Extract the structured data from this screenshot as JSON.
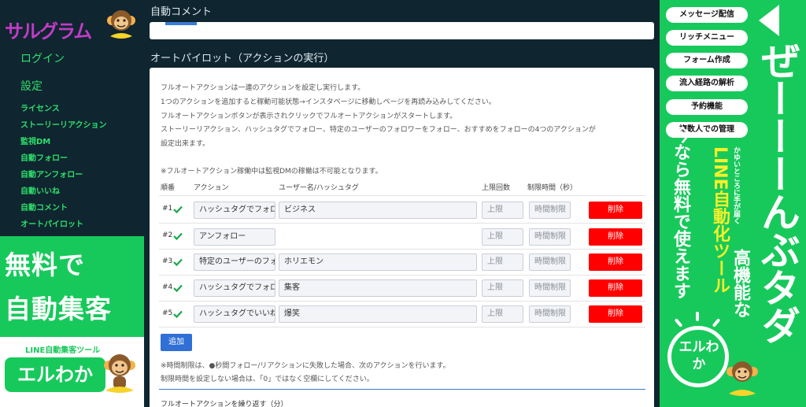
{
  "sidebar": {
    "logo_text": "サルグラム",
    "nav_big": [
      "ログイン",
      "設定"
    ],
    "nav_small": [
      "ライセンス",
      "ストーリーリアクション",
      "監視DM",
      "自動フォロー",
      "自動アンフォロー",
      "自動いいね",
      "自動コメント",
      "オートパイロット"
    ]
  },
  "left_ad": {
    "line1": "無料で",
    "line2": "自動集客",
    "tag": "LINE自動集客ツール",
    "brand": "エルわか"
  },
  "main": {
    "section_auto_comment": "自動コメント",
    "section_autopilot": "オートパイロット（アクションの実行）",
    "desc": [
      "フルオートアクションは一連のアクションを設定し実行します。",
      "1つのアクションを追加すると稼動可能状態→インスタページに移動しページを再読み込みしてください。",
      "フルオートアクションボタンが表示されクリックでフルオートアクションがスタートします。",
      "ストーリーリアクション、ハッシュタグでフォロー、特定のユーザーのフォロワーをフォロー、おすすめをフォローの4つのアクションが",
      "設定出来ます。"
    ],
    "warning": "※フルオートアクション稼働中は監視DMの稼働は不可能となります。",
    "headers": {
      "order": "順番",
      "action": "アクション",
      "user": "ユーザー名/ハッシュタグ",
      "limit": "上限回数",
      "time": "制限時間（秒）"
    },
    "rows": [
      {
        "num": "#1",
        "action": "ハッシュタグでフォロー",
        "user": "ビジネス",
        "limit_ph": "上限",
        "time_ph": "時間制限",
        "delete": "削除"
      },
      {
        "num": "#2",
        "action": "アンフォロー",
        "user": "",
        "limit_ph": "上限",
        "time_ph": "時間制限",
        "delete": "削除"
      },
      {
        "num": "#3",
        "action": "特定のユーザーのフォロワー",
        "user": "ホリエモン",
        "limit_ph": "上限",
        "time_ph": "時間制限",
        "delete": "削除"
      },
      {
        "num": "#4",
        "action": "ハッシュタグでフォロー",
        "user": "集客",
        "limit_ph": "上限",
        "time_ph": "時間制限",
        "delete": "削除"
      },
      {
        "num": "#5",
        "action": "ハッシュタグでいいね",
        "user": "爆笑",
        "limit_ph": "上限",
        "time_ph": "時間制限",
        "delete": "削除"
      }
    ],
    "add_label": "追加",
    "note1": "※時間制限は、●秒間フォロー/リアクションに失敗した場合、次のアクションを行います。",
    "note2": "制限時間を設定しない場合は、「0」ではなく空欄にしてください。",
    "bottom_label": "フルオートアクションを繰り返す（分）"
  },
  "right_ad": {
    "pills": [
      "メッセージ配信",
      "リッチメニュー",
      "フォーム作成",
      "流入経路の解析",
      "予約機能",
      "複数人での管理"
    ],
    "big": "ぜーーーんぶタダ",
    "small": "かゆいところに手が届く",
    "col_white": "高機能な",
    "col_yellow": "LINE自動化ツール",
    "col_white3": "今なら無料で使えます",
    "brand": "エルわか"
  }
}
